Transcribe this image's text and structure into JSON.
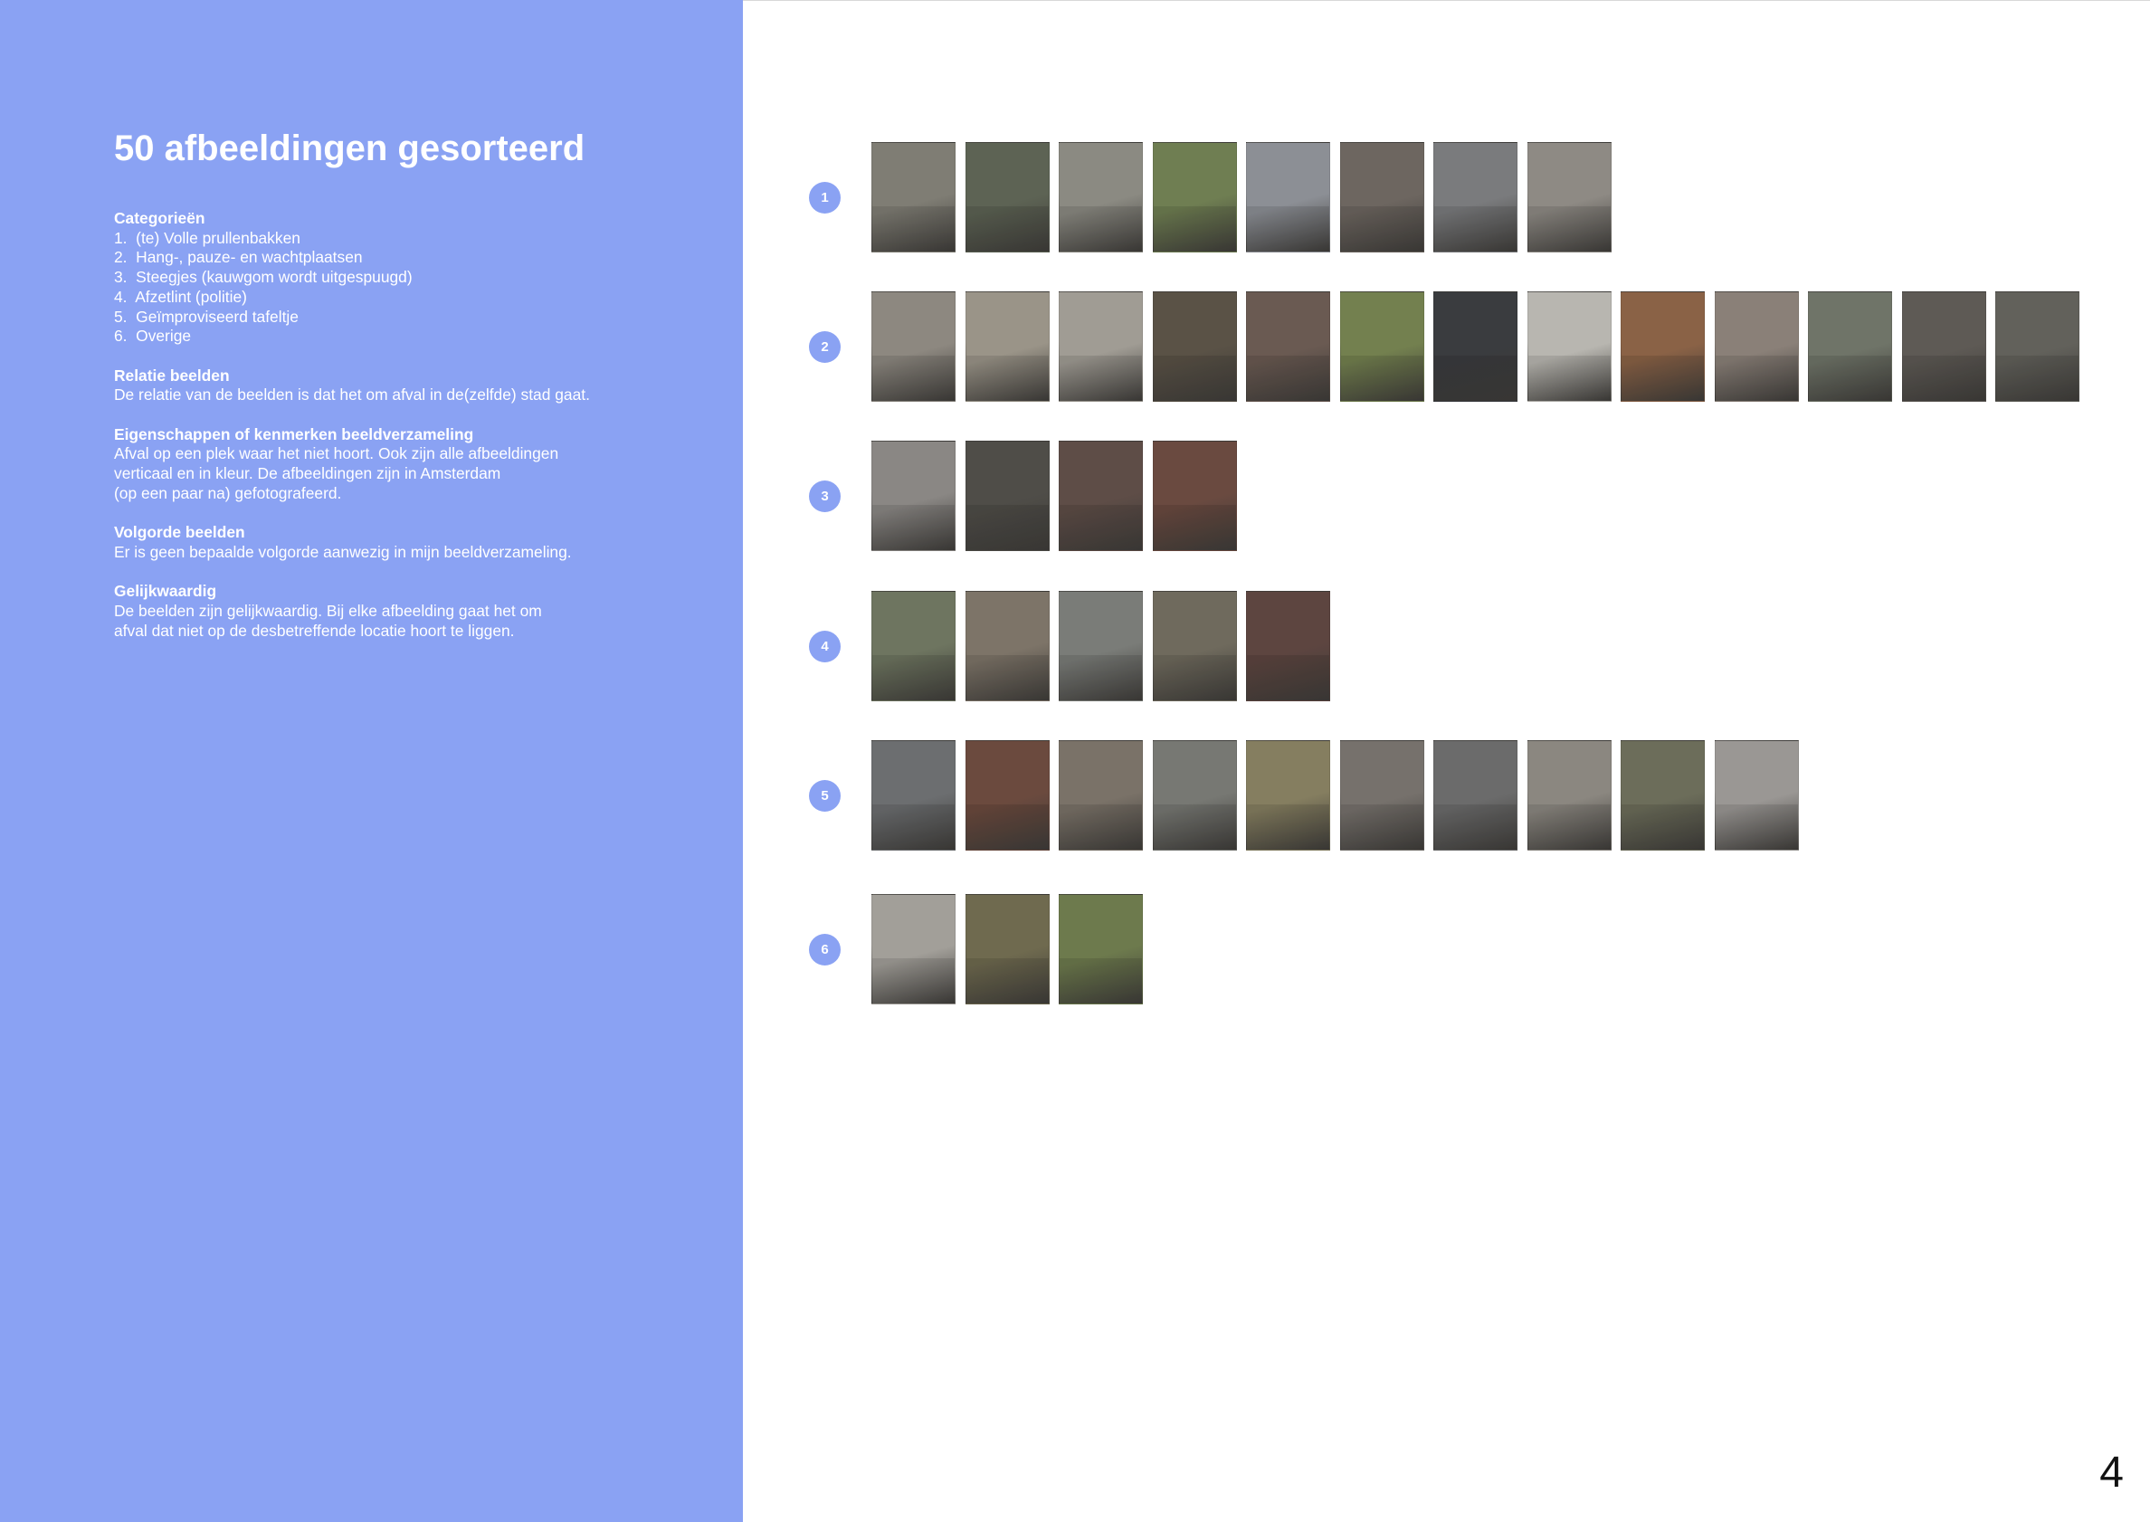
{
  "title": "50 afbeeldingen gesorteerd",
  "sections": [
    {
      "heading": "Categorieën",
      "lines": [
        "1.  (te) Volle prullenbakken",
        "2.  Hang-, pauze- en wachtplaatsen",
        "3.  Steegjes (kauwgom wordt uitgespuugd)",
        "4.  Afzetlint (politie)",
        "5.  Geïmproviseerd tafeltje",
        "6.  Overige"
      ]
    },
    {
      "heading": "Relatie beelden",
      "lines": [
        "De relatie van de beelden is dat het om afval in de(zelfde) stad gaat."
      ]
    },
    {
      "heading": "Eigenschappen of kenmerken beeldverzameling",
      "lines": [
        "Afval op een plek waar het niet hoort. Ook zijn alle afbeeldingen",
        "verticaal en in kleur. De afbeeldingen zijn in Amsterdam",
        "(op een paar na) gefotografeerd."
      ]
    },
    {
      "heading": "Volgorde beelden",
      "lines": [
        "Er is geen bepaalde volgorde aanwezig in mijn beeldverzameling."
      ]
    },
    {
      "heading": "Gelijkwaardig",
      "lines": [
        "De beelden zijn gelijkwaardig. Bij elke afbeelding gaat het om",
        "afval dat niet op de desbetreffende locatie hoort te liggen."
      ]
    }
  ],
  "rows": [
    {
      "badge": "1",
      "count": 8
    },
    {
      "badge": "2",
      "count": 13
    },
    {
      "badge": "3",
      "count": 4
    },
    {
      "badge": "4",
      "count": 5
    },
    {
      "badge": "5",
      "count": 10
    },
    {
      "badge": "6",
      "count": 3
    }
  ],
  "page_number": "4",
  "colors": {
    "panel": "#8aa2f3",
    "badge": "#8aa2f3",
    "text_on_panel": "#ffffff"
  }
}
